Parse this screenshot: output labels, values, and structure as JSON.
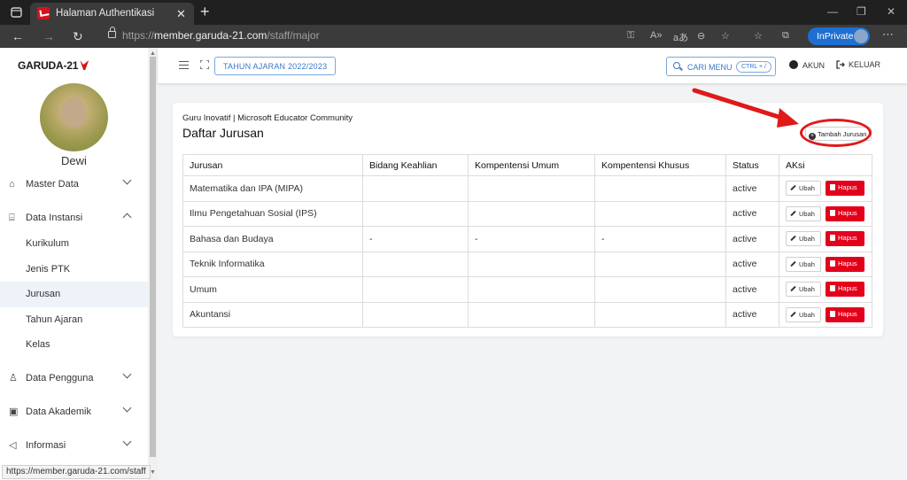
{
  "browser": {
    "tab_title": "Halaman Authentikasi",
    "url_prefix": "https://",
    "url_host": "member.garuda-21.com",
    "url_path": "/staff/major",
    "inprivate_label": "InPrivate",
    "status_url": "https://member.garuda-21.com/staff"
  },
  "sidebar": {
    "brand": "GARUDA-21",
    "username": "Dewi",
    "menu": [
      {
        "label": "Master Data",
        "icon": "home-icon",
        "expanded": false
      },
      {
        "label": "Data Instansi",
        "icon": "institution-icon",
        "expanded": true,
        "children": [
          {
            "label": "Kurikulum",
            "active": false
          },
          {
            "label": "Jenis PTK",
            "active": false
          },
          {
            "label": "Jurusan",
            "active": true
          },
          {
            "label": "Tahun Ajaran",
            "active": false
          },
          {
            "label": "Kelas",
            "active": false
          }
        ]
      },
      {
        "label": "Data Pengguna",
        "icon": "user-icon",
        "expanded": false
      },
      {
        "label": "Data Akademik",
        "icon": "book-icon",
        "expanded": false
      },
      {
        "label": "Informasi",
        "icon": "megaphone-icon",
        "expanded": false
      }
    ]
  },
  "topbar": {
    "year_button": "TAHUN AJARAN 2022/2023",
    "search_label": "CARI MENU",
    "search_shortcut": "CTRL + /",
    "account_label": "AKUN",
    "logout_label": "KELUAR"
  },
  "card": {
    "subtitle": "Guru Inovatif | Microsoft Educator Community",
    "title": "Daftar Jurusan",
    "add_button": "Tambah Jurusan"
  },
  "table": {
    "columns": [
      "Jurusan",
      "Bidang Keahlian",
      "Kompentensi Umum",
      "Kompentensi Khusus",
      "Status",
      "AKsi"
    ],
    "rows": [
      {
        "jurusan": "Matematika dan IPA (MIPA)",
        "bidang": "",
        "umum": "",
        "khusus": "",
        "status": "active"
      },
      {
        "jurusan": "Ilmu Pengetahuan Sosial (IPS)",
        "bidang": "",
        "umum": "",
        "khusus": "",
        "status": "active"
      },
      {
        "jurusan": "Bahasa dan Budaya",
        "bidang": "-",
        "umum": "-",
        "khusus": "-",
        "status": "active"
      },
      {
        "jurusan": "Teknik Informatika",
        "bidang": "",
        "umum": "",
        "khusus": "",
        "status": "active"
      },
      {
        "jurusan": "Umum",
        "bidang": "",
        "umum": "",
        "khusus": "",
        "status": "active"
      },
      {
        "jurusan": "Akuntansi",
        "bidang": "",
        "umum": "",
        "khusus": "",
        "status": "active"
      }
    ],
    "edit_label": "Ubah",
    "delete_label": "Hapus"
  },
  "colors": {
    "accent_blue": "#3a77c8",
    "danger_red": "#e3001b",
    "annotation_red": "#e01919",
    "inprivate_blue": "#1f6fd1"
  }
}
